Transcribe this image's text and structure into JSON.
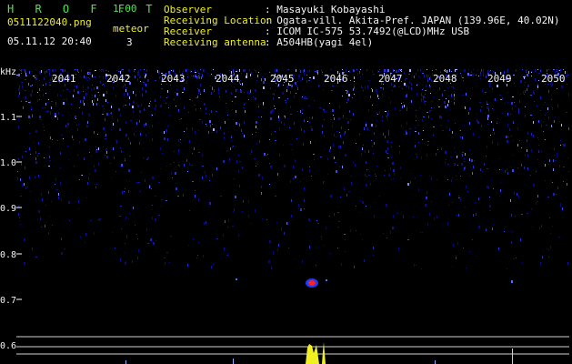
{
  "header": {
    "app_name": "H R O F F T",
    "version": "1.00",
    "filename": "0511122040.png",
    "datetime": "05.11.12 20:40",
    "meteor_label": "meteor",
    "meteor_count": "3"
  },
  "info": [
    {
      "key": "Observer",
      "value": ": Masayuki Kobayashi"
    },
    {
      "key": "Receiving Location",
      "value": ": Ogata-vill. Akita-Pref. JAPAN (139.96E, 40.02N)"
    },
    {
      "key": "Receiver",
      "value": ": ICOM IC-575 53.7492(@LCD)MHz USB"
    },
    {
      "key": "Receiving antenna",
      "value": ": A504HB(yagi 4el)"
    }
  ],
  "y_unit": "kHz",
  "y_ticks": [
    "1.1",
    "1.0",
    "0.9",
    "0.8",
    "0.7",
    "0.6"
  ],
  "x_ticks": [
    "2041",
    "2042",
    "2043",
    "2044",
    "2045",
    "2046",
    "2047",
    "2048",
    "2049",
    "2050"
  ],
  "colors": {
    "background": "#000000",
    "noise_dark": "#0a0a80",
    "noise_light": "#6a78ff",
    "echo_core": "#ff2020",
    "meter_bar": "#f0f020",
    "header_green": "#48e848",
    "header_yellow": "#f0f020",
    "header_white": "#f4f4f4"
  }
}
